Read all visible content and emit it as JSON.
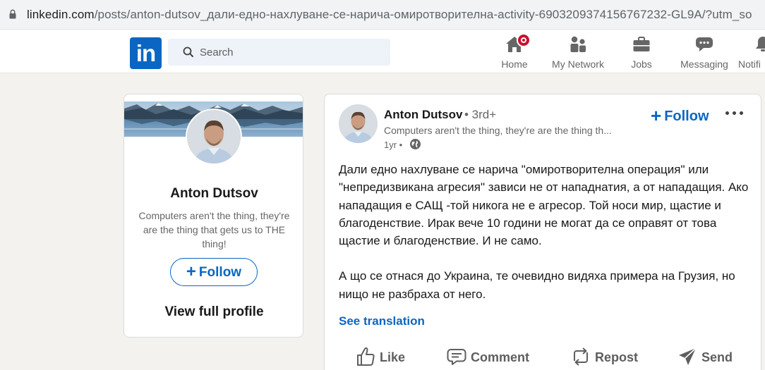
{
  "browser": {
    "url_host": "linkedin.com",
    "url_path": "/posts/anton-dutsov_дали-едно-нахлуване-се-нарича-омиротворителна-activity-6903209374156767232-GL9A/?utm_so"
  },
  "nav": {
    "logo_text": "in",
    "search_placeholder": "Search",
    "items": [
      {
        "label": "Home",
        "icon": "home-icon",
        "has_badge": true
      },
      {
        "label": "My Network",
        "icon": "people-icon"
      },
      {
        "label": "Jobs",
        "icon": "briefcase-icon"
      },
      {
        "label": "Messaging",
        "icon": "chat-icon"
      },
      {
        "label": "Notifi",
        "icon": "bell-icon"
      }
    ]
  },
  "profile_card": {
    "name": "Anton Dutsov",
    "tagline": "Computers aren't the thing, they're are the thing that gets us to THE thing!",
    "follow_label": "Follow",
    "view_profile_label": "View full profile"
  },
  "post": {
    "author_name": "Anton Dutsov",
    "degree": "• 3rd+",
    "author_tagline": "Computers aren't the thing, they're are the thing th...",
    "time": "1yr •",
    "follow_label": "Follow",
    "paragraph1": "Дали едно нахлуване се нарича \"омиротворителна операция\" или \"непредизвикана агресия\" зависи не от нападнатия, а от нападащия. Ако нападащия е САЩ -той никога не е агресор. Той носи мир, щастие и благоденствие. Ирак вече 10 години не могат да се оправят от това щастие и благоденствие. И не само.",
    "paragraph2": "А що се отнася до Украина, те очевидно видяха примера на Грузия, но нищо не разбраха от него.",
    "see_translation": "See translation",
    "actions": {
      "like": "Like",
      "comment": "Comment",
      "repost": "Repost",
      "send": "Send"
    }
  },
  "colors": {
    "brand_blue": "#0a66c2",
    "page_bg": "#f4f2ee",
    "badge_red": "#cb112d"
  }
}
